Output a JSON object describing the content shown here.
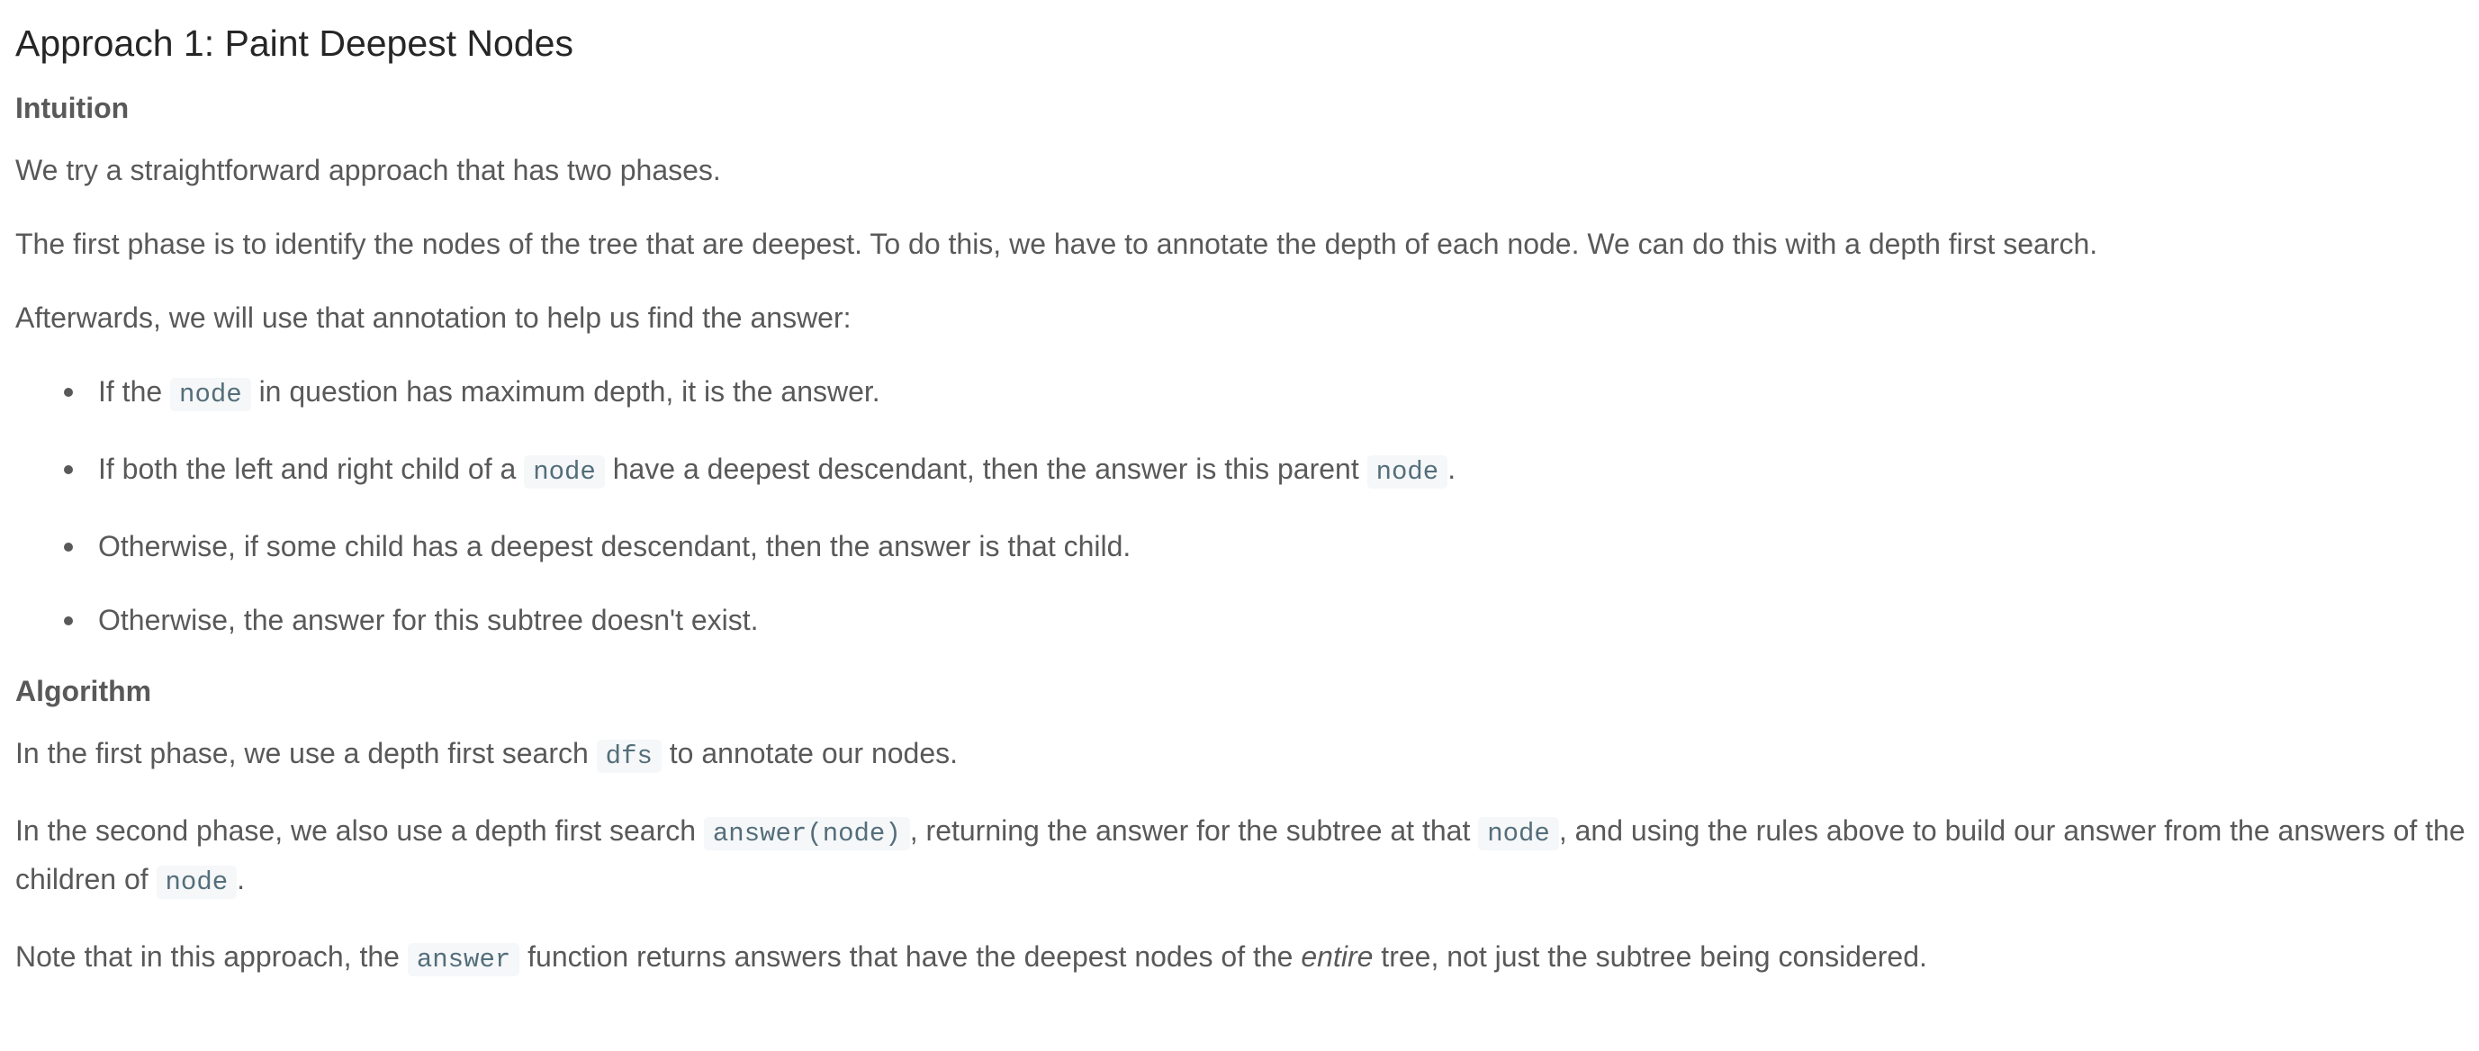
{
  "title": "Approach 1: Paint Deepest Nodes",
  "intuition": {
    "heading": "Intuition",
    "p1": "We try a straightforward approach that has two phases.",
    "p2": "The first phase is to identify the nodes of the tree that are deepest. To do this, we have to annotate the depth of each node. We can do this with a depth first search.",
    "p3": "Afterwards, we will use that annotation to help us find the answer:",
    "rules": [
      {
        "before": "If the ",
        "code": "node",
        "after": " in question has maximum depth, it is the answer."
      },
      {
        "before": "If both the left and right child of a ",
        "code": "node",
        "middle": " have a deepest descendant, then the answer is this parent ",
        "code2": "node",
        "after": "."
      },
      {
        "text": "Otherwise, if some child has a deepest descendant, then the answer is that child."
      },
      {
        "text": "Otherwise, the answer for this subtree doesn't exist."
      }
    ]
  },
  "algorithm": {
    "heading": "Algorithm",
    "p1": {
      "before": "In the first phase, we use a depth first search ",
      "code": "dfs",
      "after": " to annotate our nodes."
    },
    "p2": {
      "before": "In the second phase, we also use a depth first search ",
      "code": "answer(node)",
      "middle": ", returning the answer for the subtree at that ",
      "code2": "node",
      "middle2": ", and using the rules above to build our answer from the answers of the children of ",
      "code3": "node",
      "after": "."
    },
    "p3": {
      "before": "Note that in this approach, the ",
      "code": "answer",
      "middle": " function returns answers that have the deepest nodes of the ",
      "emphasis": "entire",
      "after": " tree, not just the subtree being considered."
    }
  }
}
